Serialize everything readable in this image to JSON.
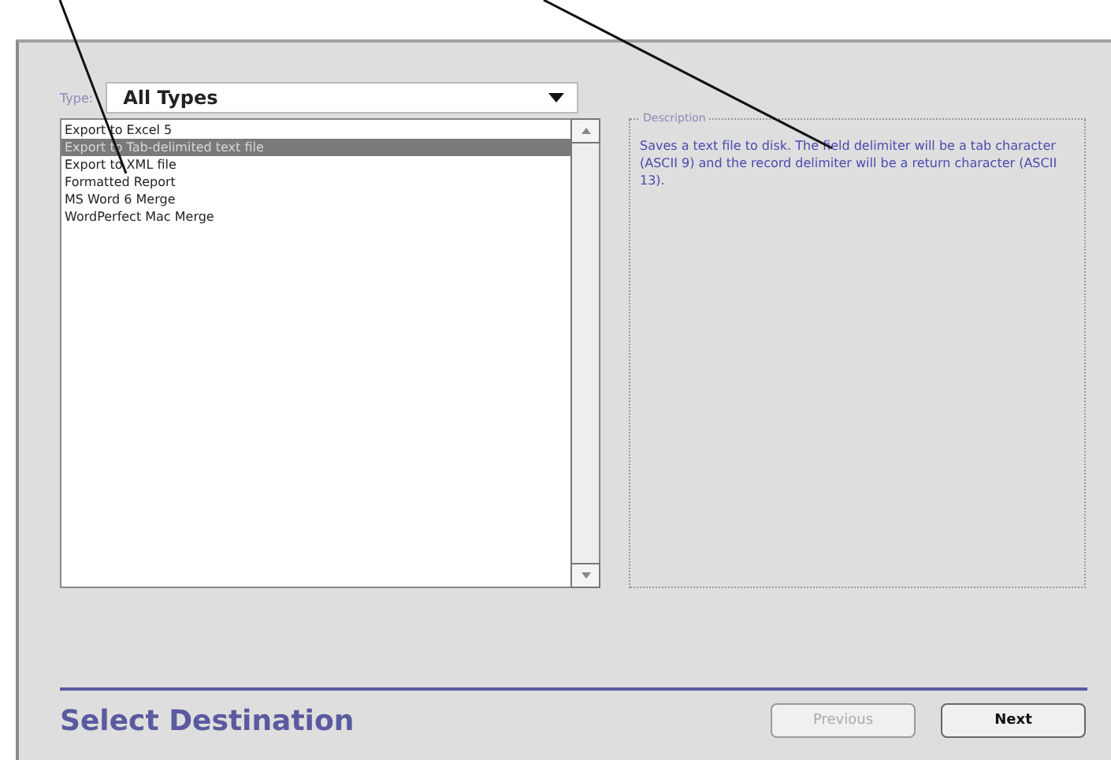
{
  "type_field": {
    "label": "Type:",
    "value": "All Types"
  },
  "list": {
    "items": [
      {
        "label": "Export to Excel 5",
        "selected": false
      },
      {
        "label": "Export to Tab-delimited text file",
        "selected": true
      },
      {
        "label": "Export to XML file",
        "selected": false
      },
      {
        "label": "Formatted Report",
        "selected": false
      },
      {
        "label": "MS Word 6 Merge",
        "selected": false
      },
      {
        "label": "WordPerfect Mac Merge",
        "selected": false
      }
    ]
  },
  "description": {
    "title": "Description",
    "text": "Saves a text file to disk. The field delimiter will be a tab character (ASCII 9) and the record delimiter will be a return character (ASCII 13)."
  },
  "footer": {
    "title": "Select Destination",
    "buttons": [
      {
        "label": "Previous",
        "disabled": true
      },
      {
        "label": "Next",
        "disabled": false
      }
    ]
  },
  "callouts": [
    {
      "kind": "leader"
    },
    {
      "kind": "leader"
    }
  ]
}
